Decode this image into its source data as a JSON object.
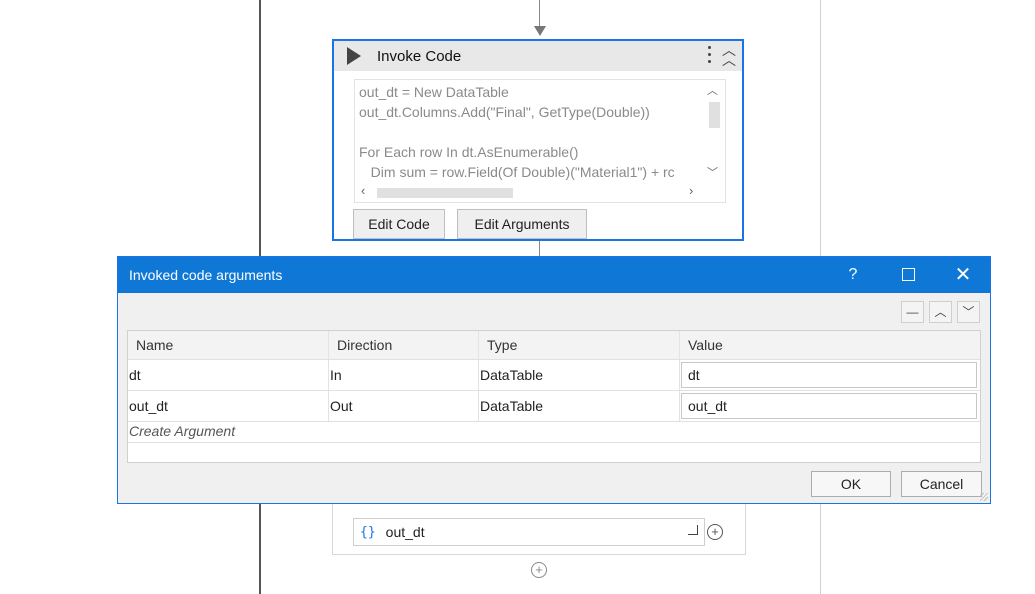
{
  "activity": {
    "title": "Invoke Code",
    "code_lines": [
      "out_dt = New DataTable",
      "out_dt.Columns.Add(\"Final\", GetType(Double))",
      "",
      "For Each row In dt.AsEnumerable()",
      "   Dim sum = row.Field(Of Double)(\"Material1\") + rc"
    ],
    "edit_code_label": "Edit Code",
    "edit_arguments_label": "Edit Arguments"
  },
  "lower_activity": {
    "braces_icon": "{}",
    "argument_text": "out_dt"
  },
  "dialog": {
    "title": "Invoked code arguments",
    "help_label": "?",
    "columns": [
      "Name",
      "Direction",
      "Type",
      "Value"
    ],
    "rows": [
      {
        "name": "dt",
        "direction": "In",
        "type": "DataTable",
        "value": "dt"
      },
      {
        "name": "out_dt",
        "direction": "Out",
        "type": "DataTable",
        "value": "out_dt"
      }
    ],
    "create_argument_label": "Create Argument",
    "ok_label": "OK",
    "cancel_label": "Cancel"
  },
  "colors": {
    "accent": "#1a73e8",
    "titlebar": "#0f78d7"
  }
}
